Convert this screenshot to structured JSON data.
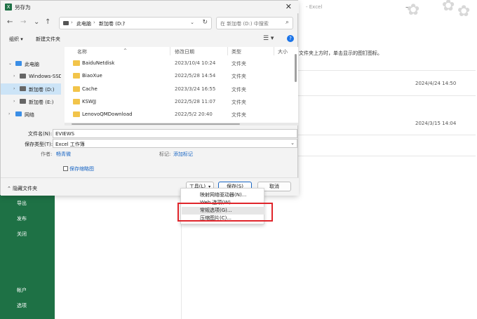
{
  "dialog": {
    "title": "另存为",
    "app_icon_letter": "X",
    "close": "✕"
  },
  "nav": {
    "back": "←",
    "forward": "→",
    "recent": "⌄",
    "up": "↑",
    "breadcrumb": [
      "此电脑",
      "新加卷 (D:)"
    ],
    "refresh": "↻",
    "search_placeholder": "在 新加卷 (D:) 中搜索"
  },
  "toolbar": {
    "organize": "组织 ▾",
    "new_folder": "新建文件夹"
  },
  "sidebar": {
    "items": [
      {
        "label": "此电脑",
        "icon": "computer-icon",
        "selected": false
      },
      {
        "label": "Windows-SSD",
        "icon": "drive-icon",
        "selected": false
      },
      {
        "label": "新加卷 (D:)",
        "icon": "drive-icon",
        "selected": true
      },
      {
        "label": "新加卷 (E:)",
        "icon": "drive-icon",
        "selected": false
      },
      {
        "label": "网络",
        "icon": "network-icon",
        "selected": false
      }
    ]
  },
  "columns": {
    "name": "名称",
    "date": "修改日期",
    "type": "类型",
    "size": "大小"
  },
  "files": [
    {
      "name": "BaiduNetdisk",
      "date": "2023/10/4 10:24",
      "type": "文件夹"
    },
    {
      "name": "BiaoXue",
      "date": "2022/5/28 14:54",
      "type": "文件夹"
    },
    {
      "name": "Cache",
      "date": "2023/3/24 16:55",
      "type": "文件夹"
    },
    {
      "name": "KSWJJ",
      "date": "2022/5/28 11:07",
      "type": "文件夹"
    },
    {
      "name": "LenovoQMDownload",
      "date": "2022/5/2 20:40",
      "type": "文件夹"
    }
  ],
  "fields": {
    "filename_label": "文件名(N):",
    "filename_value": "EVIEWS",
    "savetype_label": "保存类型(T):",
    "savetype_value": "Excel 工作簿",
    "author_label": "作者:",
    "author_value": "畅青微",
    "tags_label": "标记:",
    "tags_value": "添加标记",
    "thumbnail_label": "保存缩略图"
  },
  "footer": {
    "hide_folders": "隐藏文件夹",
    "tools": "工具(L)",
    "save": "保存(S)",
    "cancel": "取消"
  },
  "tools_menu": [
    "映射网络驱动器(N)...",
    "Web 选项(W)...",
    "常规选项(G)...",
    "压缩图片(C)..."
  ],
  "background": {
    "app_title": "- Excel",
    "hint": "文件夹上方时，单击显示的图钉图标。",
    "date1": "2024/4/24 14:50",
    "date2": "2024/3/15 14:04",
    "side_items": [
      "导出",
      "发布",
      "关闭",
      "帐户",
      "选项"
    ]
  },
  "colors": {
    "excel_green": "#1e7145",
    "highlight_red": "#e0252b",
    "link_blue": "#1a66c4"
  }
}
